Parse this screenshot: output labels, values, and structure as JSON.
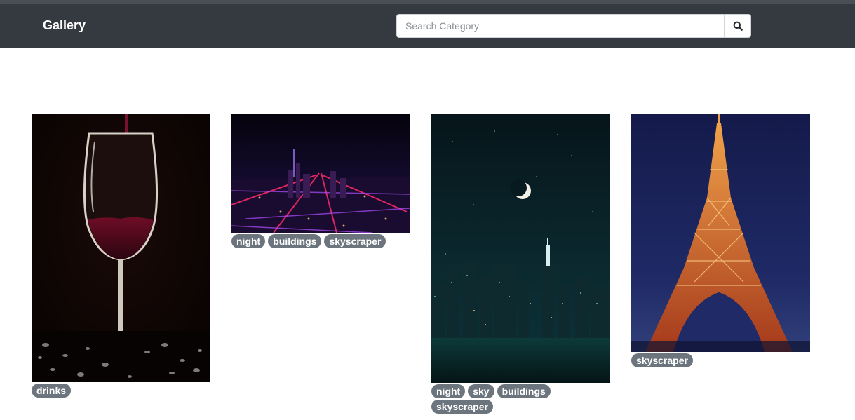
{
  "navbar": {
    "brand": "Gallery",
    "search": {
      "placeholder": "Search Category",
      "value": ""
    },
    "search_button_icon": "search-icon"
  },
  "gallery": {
    "cards": [
      {
        "image": "wine-glass-pour-photo",
        "tags": [
          "drinks"
        ]
      },
      {
        "image": "city-night-aerial-photo",
        "tags": [
          "night",
          "buildings",
          "skyscraper"
        ]
      },
      {
        "image": "night-skyline-moon-photo",
        "tags": [
          "night",
          "sky",
          "buildings",
          "skyscraper"
        ]
      },
      {
        "image": "eiffel-tower-night-photo",
        "tags": [
          "skyscraper"
        ]
      }
    ]
  },
  "colors": {
    "navbar": "#343a40",
    "tag": "#6c757d",
    "background": "#ffffff"
  }
}
